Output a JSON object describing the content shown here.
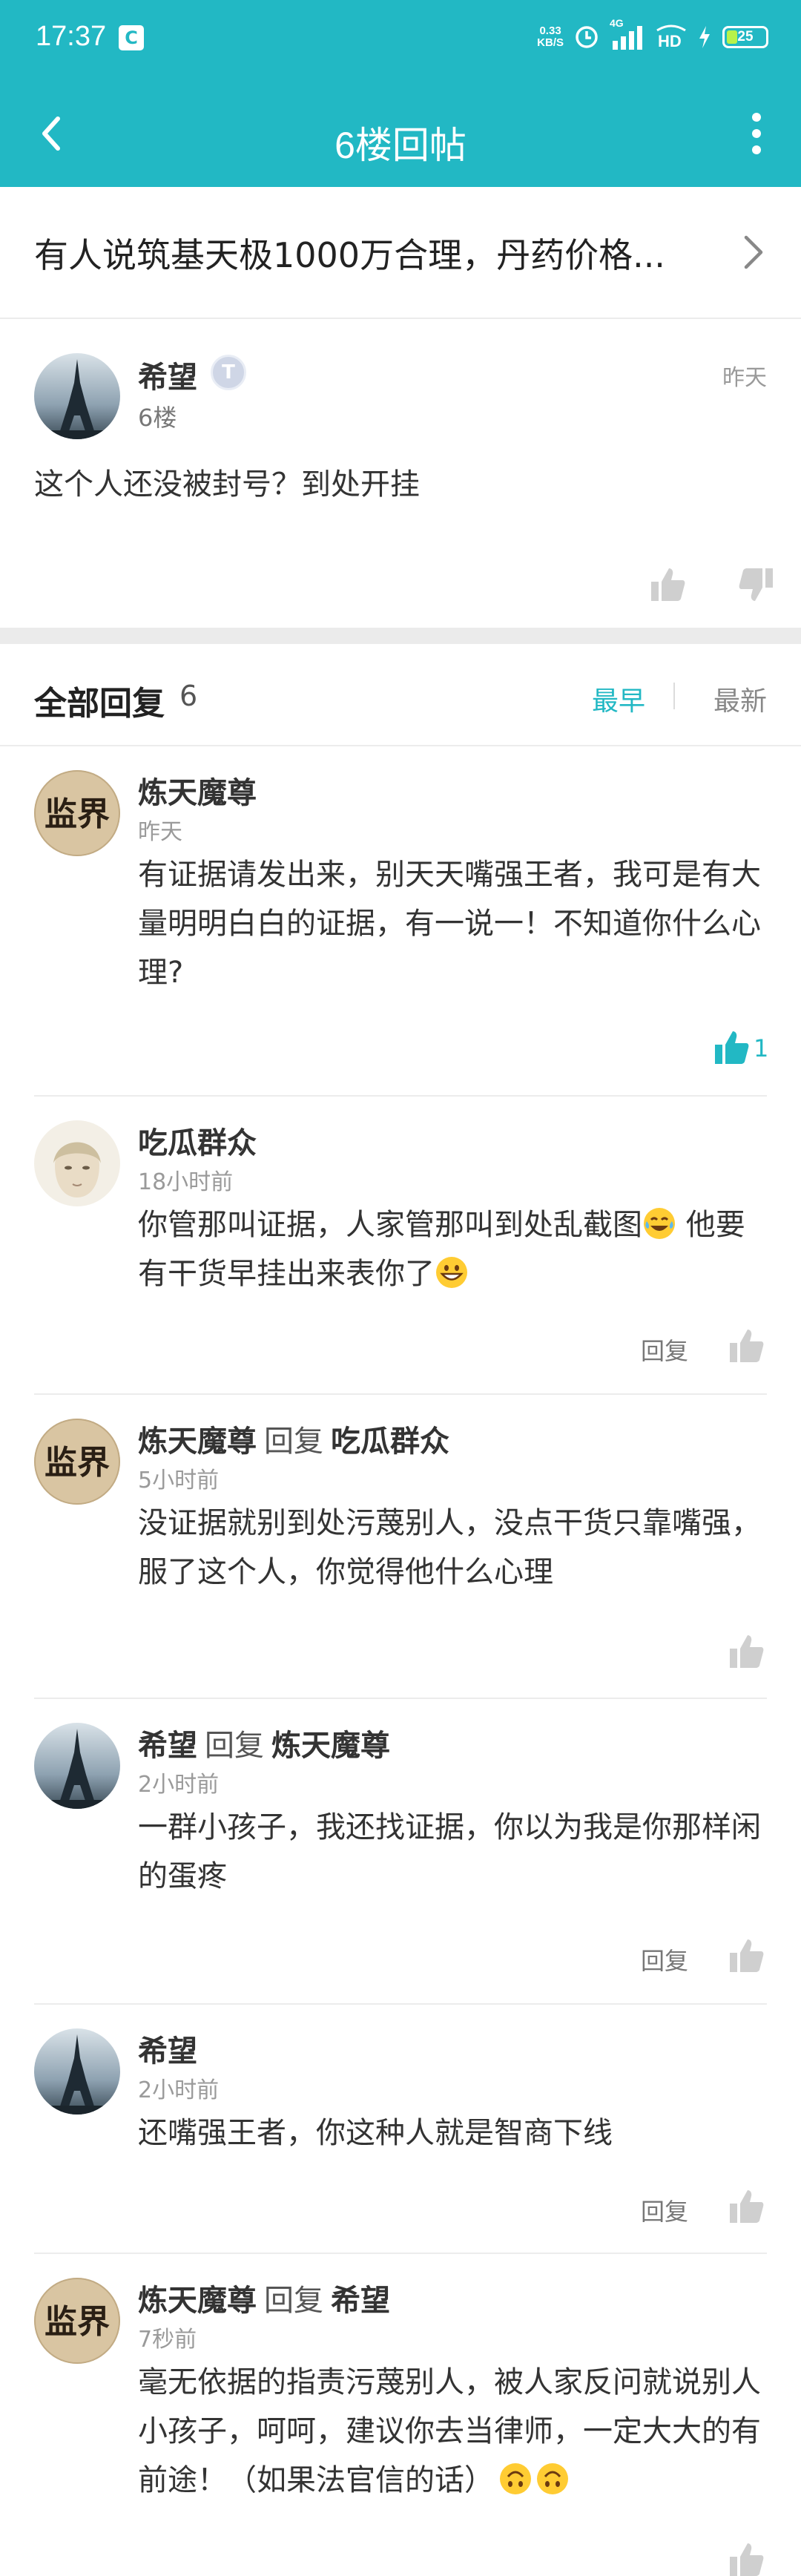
{
  "status_bar": {
    "time": "17:37",
    "app_icon": "C",
    "net_speed_value": "0.33",
    "net_speed_unit": "KB/S",
    "network": "4G",
    "hd": "HD",
    "battery": "25"
  },
  "nav": {
    "title": "6楼回帖"
  },
  "thread": {
    "title": "有人说筑基天极1000万合理，丹药价格..."
  },
  "post": {
    "author": "希望",
    "level_badge": "T",
    "floor": "6楼",
    "time": "昨天",
    "content": "这个人还没被封号？到处开挂"
  },
  "replies_header": {
    "title": "全部回复",
    "count": "6",
    "sort_earliest": "最早",
    "sort_latest": "最新"
  },
  "replies": [
    {
      "author": "炼天魔尊",
      "reply_word": "",
      "reply_to": "",
      "time": "昨天",
      "content": "有证据请发出来，别天天嘴强王者，我可是有大量明明白白的证据，有一说一！不知道你什么心理?",
      "likes": "1",
      "reply_label": ""
    },
    {
      "author": "吃瓜群众",
      "reply_word": "",
      "reply_to": "",
      "time": "18小时前",
      "content_a": "你管那叫证据，人家管那叫到处乱截图",
      "content_b": " 他要有干货早挂出来表你了",
      "reply_label": "回复"
    },
    {
      "author": "炼天魔尊",
      "reply_word": "回复",
      "reply_to": "吃瓜群众",
      "time": "5小时前",
      "content": "没证据就别到处污蔑别人，没点干货只靠嘴强，服了这个人，你觉得他什么心理",
      "reply_label": ""
    },
    {
      "author": "希望",
      "reply_word": "回复",
      "reply_to": "炼天魔尊",
      "time": "2小时前",
      "content": "一群小孩子，我还找证据，你以为我是你那样闲的蛋疼",
      "reply_label": "回复"
    },
    {
      "author": "希望",
      "reply_word": "",
      "reply_to": "",
      "time": "2小时前",
      "content": "还嘴强王者，你这种人就是智商下线",
      "reply_label": "回复"
    },
    {
      "author": "炼天魔尊",
      "reply_word": "回复",
      "reply_to": "希望",
      "time": "7秒前",
      "content": "毫无依据的指责污蔑别人，被人家反问就说别人小孩子，呵呵，建议你去当律师，一定大大的有前途！（如果法官信的话）",
      "reply_label": ""
    }
  ],
  "avatar_text": {
    "lian": "监界"
  },
  "colors": {
    "accent": "#22b8c4",
    "like_active": "#22b8c4",
    "icon_gray": "#cfcfcf"
  }
}
